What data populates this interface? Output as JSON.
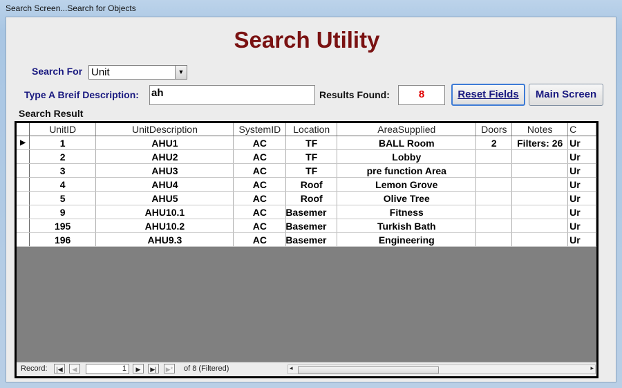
{
  "window": {
    "title": "Search Screen...Search for Objects"
  },
  "heading": "Search Utility",
  "form": {
    "search_for_label": "Search For",
    "search_for_value": "Unit",
    "description_label": "Type A Breif Description:",
    "description_value": "ah",
    "results_label": "Results Found:",
    "results_value": "8",
    "reset_button": "Reset Fields",
    "main_button": "Main Screen",
    "search_result_label": "Search Result"
  },
  "grid": {
    "columns": [
      "UnitID",
      "UnitDescription",
      "SystemID",
      "Location",
      "AreaSupplied",
      "Doors",
      "Notes",
      "C"
    ],
    "rows": [
      {
        "selected": true,
        "cells": [
          "1",
          "AHU1",
          "AC",
          "TF",
          "BALL Room",
          "2",
          "Filters: 26",
          "Ur"
        ]
      },
      {
        "selected": false,
        "cells": [
          "2",
          "AHU2",
          "AC",
          "TF",
          "Lobby",
          "",
          "",
          "Ur"
        ]
      },
      {
        "selected": false,
        "cells": [
          "3",
          "AHU3",
          "AC",
          "TF",
          "pre function Area",
          "",
          "",
          "Ur"
        ]
      },
      {
        "selected": false,
        "cells": [
          "4",
          "AHU4",
          "AC",
          "Roof",
          "Lemon Grove",
          "",
          "",
          "Ur"
        ]
      },
      {
        "selected": false,
        "cells": [
          "5",
          "AHU5",
          "AC",
          "Roof",
          "Olive Tree",
          "",
          "",
          "Ur"
        ]
      },
      {
        "selected": false,
        "cells": [
          "9",
          "AHU10.1",
          "AC",
          "Basemer",
          "Fitness",
          "",
          "",
          "Ur"
        ]
      },
      {
        "selected": false,
        "cells": [
          "195",
          "AHU10.2",
          "AC",
          "Basemer",
          "Turkish Bath",
          "",
          "",
          "Ur"
        ]
      },
      {
        "selected": false,
        "cells": [
          "196",
          "AHU9.3",
          "AC",
          "Basemer",
          "Engineering",
          "",
          "",
          "Ur"
        ]
      }
    ]
  },
  "nav": {
    "record_label": "Record:",
    "current": "1",
    "of_text": "of  8 (Filtered)"
  }
}
